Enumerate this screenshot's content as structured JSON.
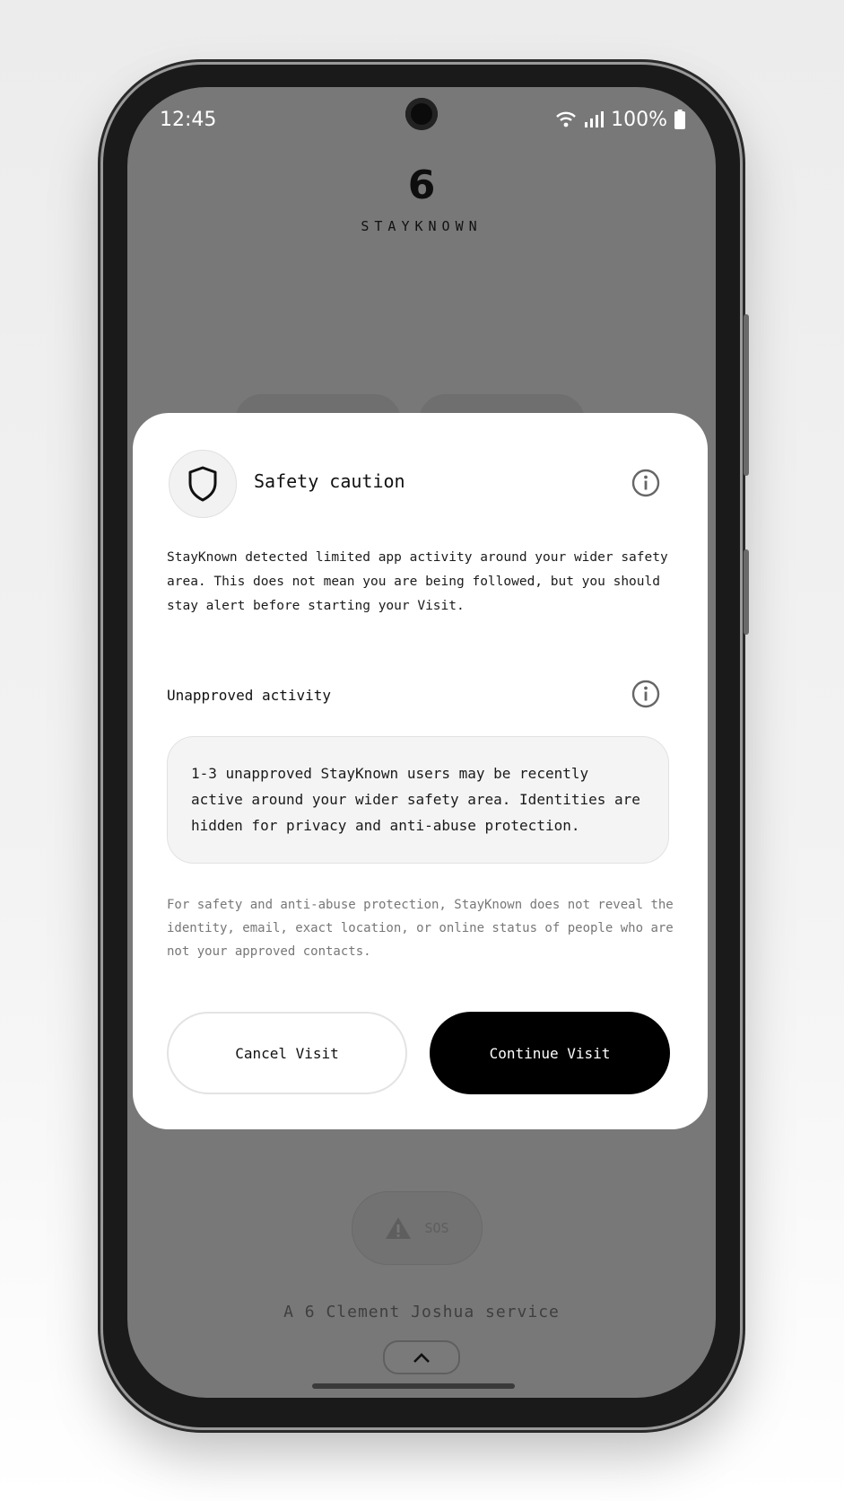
{
  "status_bar": {
    "time": "12:45",
    "battery": "100%"
  },
  "app": {
    "logo_mark": "6",
    "logo_word": "STAYKNOWN"
  },
  "dialog": {
    "title": "Safety caution",
    "body": "StayKnown detected limited app activity around your wider safety area. This does not mean you are being followed, but you should stay alert before starting your Visit.",
    "section_label": "Unapproved activity",
    "activity_text": "1-3 unapproved StayKnown users may be recently active around your wider safety area. Identities are hidden for privacy and anti-abuse protection.",
    "fine_print": "For safety and anti-abuse protection, StayKnown does not reveal the identity, email, exact location, or online status of people who are not your approved contacts.",
    "cancel_label": "Cancel Visit",
    "continue_label": "Continue Visit"
  },
  "background": {
    "sos_label": "SOS",
    "footer": "A 6 Clement Joshua service"
  },
  "icons": [
    "wifi-icon",
    "signal-icon",
    "battery-icon",
    "shield-icon",
    "info-icon",
    "warning-icon",
    "chevron-up-icon"
  ]
}
